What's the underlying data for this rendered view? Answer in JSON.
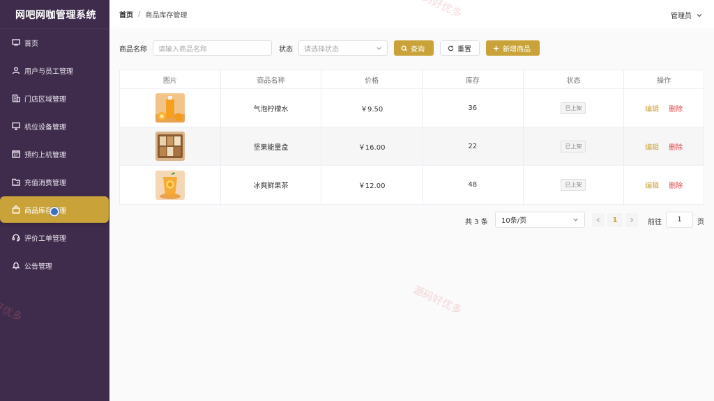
{
  "app": {
    "title": "网吧网咖管理系统"
  },
  "sidebar": {
    "items": [
      {
        "label": "首页",
        "icon": "dashboard-icon"
      },
      {
        "label": "用户与员工管理",
        "icon": "user-icon"
      },
      {
        "label": "门店区域管理",
        "icon": "building-icon"
      },
      {
        "label": "机位设备管理",
        "icon": "monitor-icon"
      },
      {
        "label": "预约上机管理",
        "icon": "calendar-icon"
      },
      {
        "label": "充值消费管理",
        "icon": "folder-icon"
      },
      {
        "label": "商品库存管理",
        "icon": "bag-icon",
        "active": true
      },
      {
        "label": "评价工单管理",
        "icon": "headset-icon"
      },
      {
        "label": "公告管理",
        "icon": "bell-icon"
      }
    ]
  },
  "header": {
    "breadcrumb_home": "首页",
    "breadcrumb_sep": "/",
    "breadcrumb_current": "商品库存管理",
    "user": "管理员"
  },
  "filters": {
    "name_label": "商品名称",
    "name_placeholder": "请输入商品名称",
    "status_label": "状态",
    "status_placeholder": "请选择状态",
    "query_label": "查询",
    "reset_label": "重置",
    "add_label": "新增商品"
  },
  "table": {
    "columns": [
      "图片",
      "商品名称",
      "价格",
      "库存",
      "状态",
      "操作"
    ],
    "rows": [
      {
        "name": "气泡柠檬水",
        "price": "￥9.50",
        "stock": "36",
        "status": "已上架",
        "edit": "编辑",
        "delete": "删除"
      },
      {
        "name": "坚果能量盒",
        "price": "￥16.00",
        "stock": "22",
        "status": "已上架",
        "edit": "编辑",
        "delete": "删除"
      },
      {
        "name": "冰爽鲜果茶",
        "price": "￥12.00",
        "stock": "48",
        "status": "已上架",
        "edit": "编辑",
        "delete": "删除"
      }
    ]
  },
  "pagination": {
    "total": "共 3 条",
    "page_size": "10条/页",
    "current_page": "1",
    "goto_label": "前往",
    "goto_value": "1",
    "page_unit": "页"
  },
  "watermark": "源码好优多",
  "colors": {
    "sidebar_bg": "#3f2c4c",
    "accent": "#c9a33a",
    "danger": "#e04848"
  }
}
